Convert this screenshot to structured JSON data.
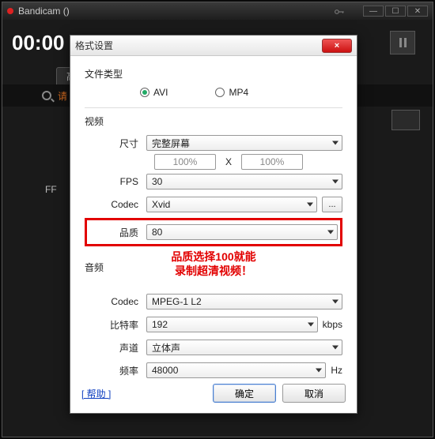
{
  "main": {
    "title": "Bandicam ()",
    "timer": "00:00",
    "tab_advanced": "高级",
    "search_prompt": "请",
    "bg_label": "FF"
  },
  "modal": {
    "title": "格式设置",
    "close_glyph": "×",
    "filetype": {
      "heading": "文件类型",
      "avi": "AVI",
      "mp4": "MP4"
    },
    "video": {
      "heading": "视频",
      "size_label": "尺寸",
      "size_value": "完整屏幕",
      "pct_left": "100%",
      "pct_x": "X",
      "pct_right": "100%",
      "fps_label": "FPS",
      "fps_value": "30",
      "codec_label": "Codec",
      "codec_value": "Xvid",
      "dots": "...",
      "quality_label": "品质",
      "quality_value": "80"
    },
    "annotation_line1": "品质选择100就能",
    "annotation_line2": "录制超清视频！",
    "audio": {
      "heading": "音频",
      "codec_label": "Codec",
      "codec_value": "MPEG-1 L2",
      "bitrate_label": "比特率",
      "bitrate_value": "192",
      "bitrate_unit": "kbps",
      "channel_label": "声道",
      "channel_value": "立体声",
      "freq_label": "频率",
      "freq_value": "48000",
      "freq_unit": "Hz"
    },
    "footer": {
      "help": "[ 帮助 ]",
      "ok": "确定",
      "cancel": "取消"
    }
  }
}
